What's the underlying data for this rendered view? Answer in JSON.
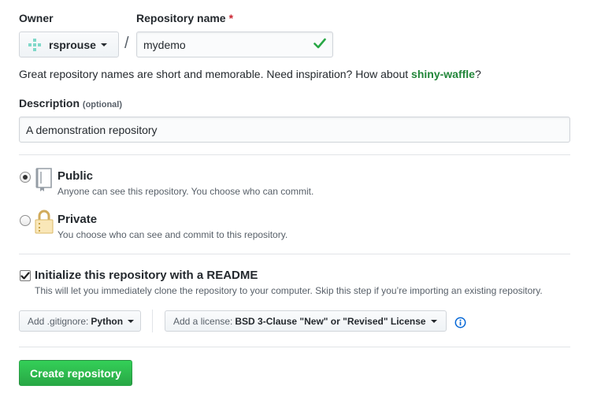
{
  "owner": {
    "label": "Owner",
    "value": "rsprouse"
  },
  "separator": "/",
  "repo_name": {
    "label": "Repository name",
    "required_mark": "*",
    "value": "mydemo",
    "valid": true
  },
  "suggestion": {
    "text": "Great repository names are short and memorable. Need inspiration? How about ",
    "name": "shiny-waffle",
    "suffix": "?"
  },
  "description": {
    "label": "Description",
    "optional": "(optional)",
    "value": "A demonstration repository"
  },
  "visibility": {
    "selected": "public",
    "options": [
      {
        "id": "public",
        "title": "Public",
        "note": "Anyone can see this repository. You choose who can commit.",
        "icon": "repo-book-icon"
      },
      {
        "id": "private",
        "title": "Private",
        "note": "You choose who can see and commit to this repository.",
        "icon": "lock-icon"
      }
    ]
  },
  "readme": {
    "checked": true,
    "title": "Initialize this repository with a README",
    "note": "This will let you immediately clone the repository to your computer. Skip this step if you’re importing an existing repository."
  },
  "gitignore": {
    "prefix": "Add .gitignore:",
    "value": "Python"
  },
  "license": {
    "prefix": "Add a license:",
    "value": "BSD 3-Clause \"New\" or \"Revised\" License"
  },
  "submit": {
    "label": "Create repository"
  },
  "colors": {
    "accent_green": "#28a745",
    "suggest_green": "#22863a",
    "info_blue": "#0366d6",
    "required_red": "#cb2431"
  }
}
